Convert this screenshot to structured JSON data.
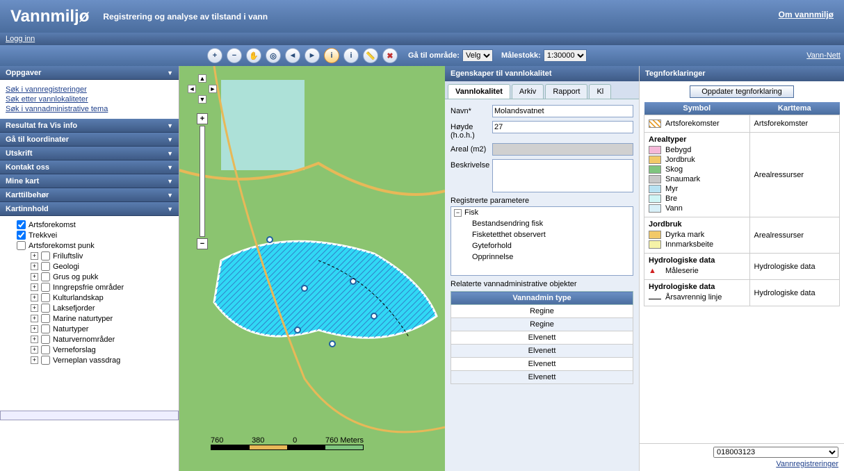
{
  "header": {
    "title": "Vannmiljø",
    "sub": "Registrering og analyse av tilstand i vann",
    "about": "Om vannmiljø"
  },
  "login": "Logg inn",
  "toolbar": {
    "goto_label": "Gå til område:",
    "goto_value": "Velg",
    "scale_label": "Målestokk:",
    "scale_value": "1:30000",
    "vann_nett": "Vann-Nett"
  },
  "left": {
    "tasks": {
      "title": "Oppgaver",
      "links": [
        "Søk i vannregistreringer",
        "Søk etter vannlokaliteter",
        "Søk i vannadministrative tema"
      ]
    },
    "panels": [
      "Resultat fra Vis info",
      "Gå til koordinater",
      "Utskrift",
      "Kontakt oss",
      "Mine kart",
      "Karttilbehør",
      "Kartinnhold"
    ],
    "tree": {
      "checked": [
        "Artsforekomst",
        "Trekkvei"
      ],
      "unchecked_top": [
        "Artsforekomst punk"
      ],
      "items": [
        "Friluftsliv",
        "Geologi",
        "Grus og pukk",
        "Inngrepsfrie områder",
        "Kulturlandskap",
        "Laksefjorder",
        "Marine naturtyper",
        "Naturtyper",
        "Naturvernområder",
        "Verneforslag",
        "Verneplan vassdrag"
      ]
    }
  },
  "map": {
    "scale_labels": [
      "760",
      "380",
      "0",
      "760 Meters"
    ]
  },
  "props": {
    "title": "Egenskaper til vannlokalitet",
    "tabs": [
      "Vannlokalitet",
      "Arkiv",
      "Rapport",
      "Kl"
    ],
    "fields": {
      "name_lbl": "Navn*",
      "name": "Molandsvatnet",
      "height_lbl": "Høyde (h.o.h.)",
      "height": "27",
      "area_lbl": "Areal (m2)",
      "desc_lbl": "Beskrivelse"
    },
    "params_lbl": "Registrerte parametere",
    "params": {
      "group": "Fisk",
      "items": [
        "Bestandsendring fisk",
        "Fisketetthet observert",
        "Gyteforhold",
        "Opprinnelse"
      ]
    },
    "rel_lbl": "Relaterte vannadministrative objekter",
    "rel_header": "Vannadmin type",
    "rel_rows": [
      "Regine",
      "Regine",
      "Elvenett",
      "Elvenett",
      "Elvenett",
      "Elvenett"
    ]
  },
  "legend": {
    "title": "Tegnforklaringer",
    "update": "Oppdater tegnforklaring",
    "cols": [
      "Symbol",
      "Karttema"
    ],
    "rows": [
      {
        "theme": "Artsforekomster",
        "items": [
          {
            "label": "Artsforekomster",
            "color": "repeating-linear-gradient(45deg,#e8a030,#e8a030 2px,#fff 2px,#fff 5px)"
          }
        ]
      },
      {
        "theme": "Arealressurser",
        "group": "Arealtyper",
        "items": [
          {
            "label": "Bebygd",
            "color": "#f5b8d8"
          },
          {
            "label": "Jordbruk",
            "color": "#f2c968"
          },
          {
            "label": "Skog",
            "color": "#7fc57f"
          },
          {
            "label": "Snaumark",
            "color": "#c8c8c8"
          },
          {
            "label": "Myr",
            "color": "#b8e2f2"
          },
          {
            "label": "Bre",
            "color": "#cff5f5"
          },
          {
            "label": "Vann",
            "color": "#d8f0f8"
          }
        ]
      },
      {
        "theme": "Arealressurser",
        "group": "Jordbruk",
        "items": [
          {
            "label": "Dyrka mark",
            "color": "#f2c968"
          },
          {
            "label": "Innmarksbeite",
            "color": "#f5f2a8"
          }
        ]
      },
      {
        "theme": "Hydrologiske data",
        "group": "Hydrologiske data",
        "items": [
          {
            "label": "Måleserie",
            "color": "",
            "tri": true
          }
        ]
      },
      {
        "theme": "Hydrologiske data",
        "group": "Hydrologiske data",
        "items": [
          {
            "label": "Årsavrennig linje",
            "color": "",
            "line": true
          }
        ]
      }
    ],
    "code": "018003123",
    "reg_link": "Vannregistreringer"
  }
}
